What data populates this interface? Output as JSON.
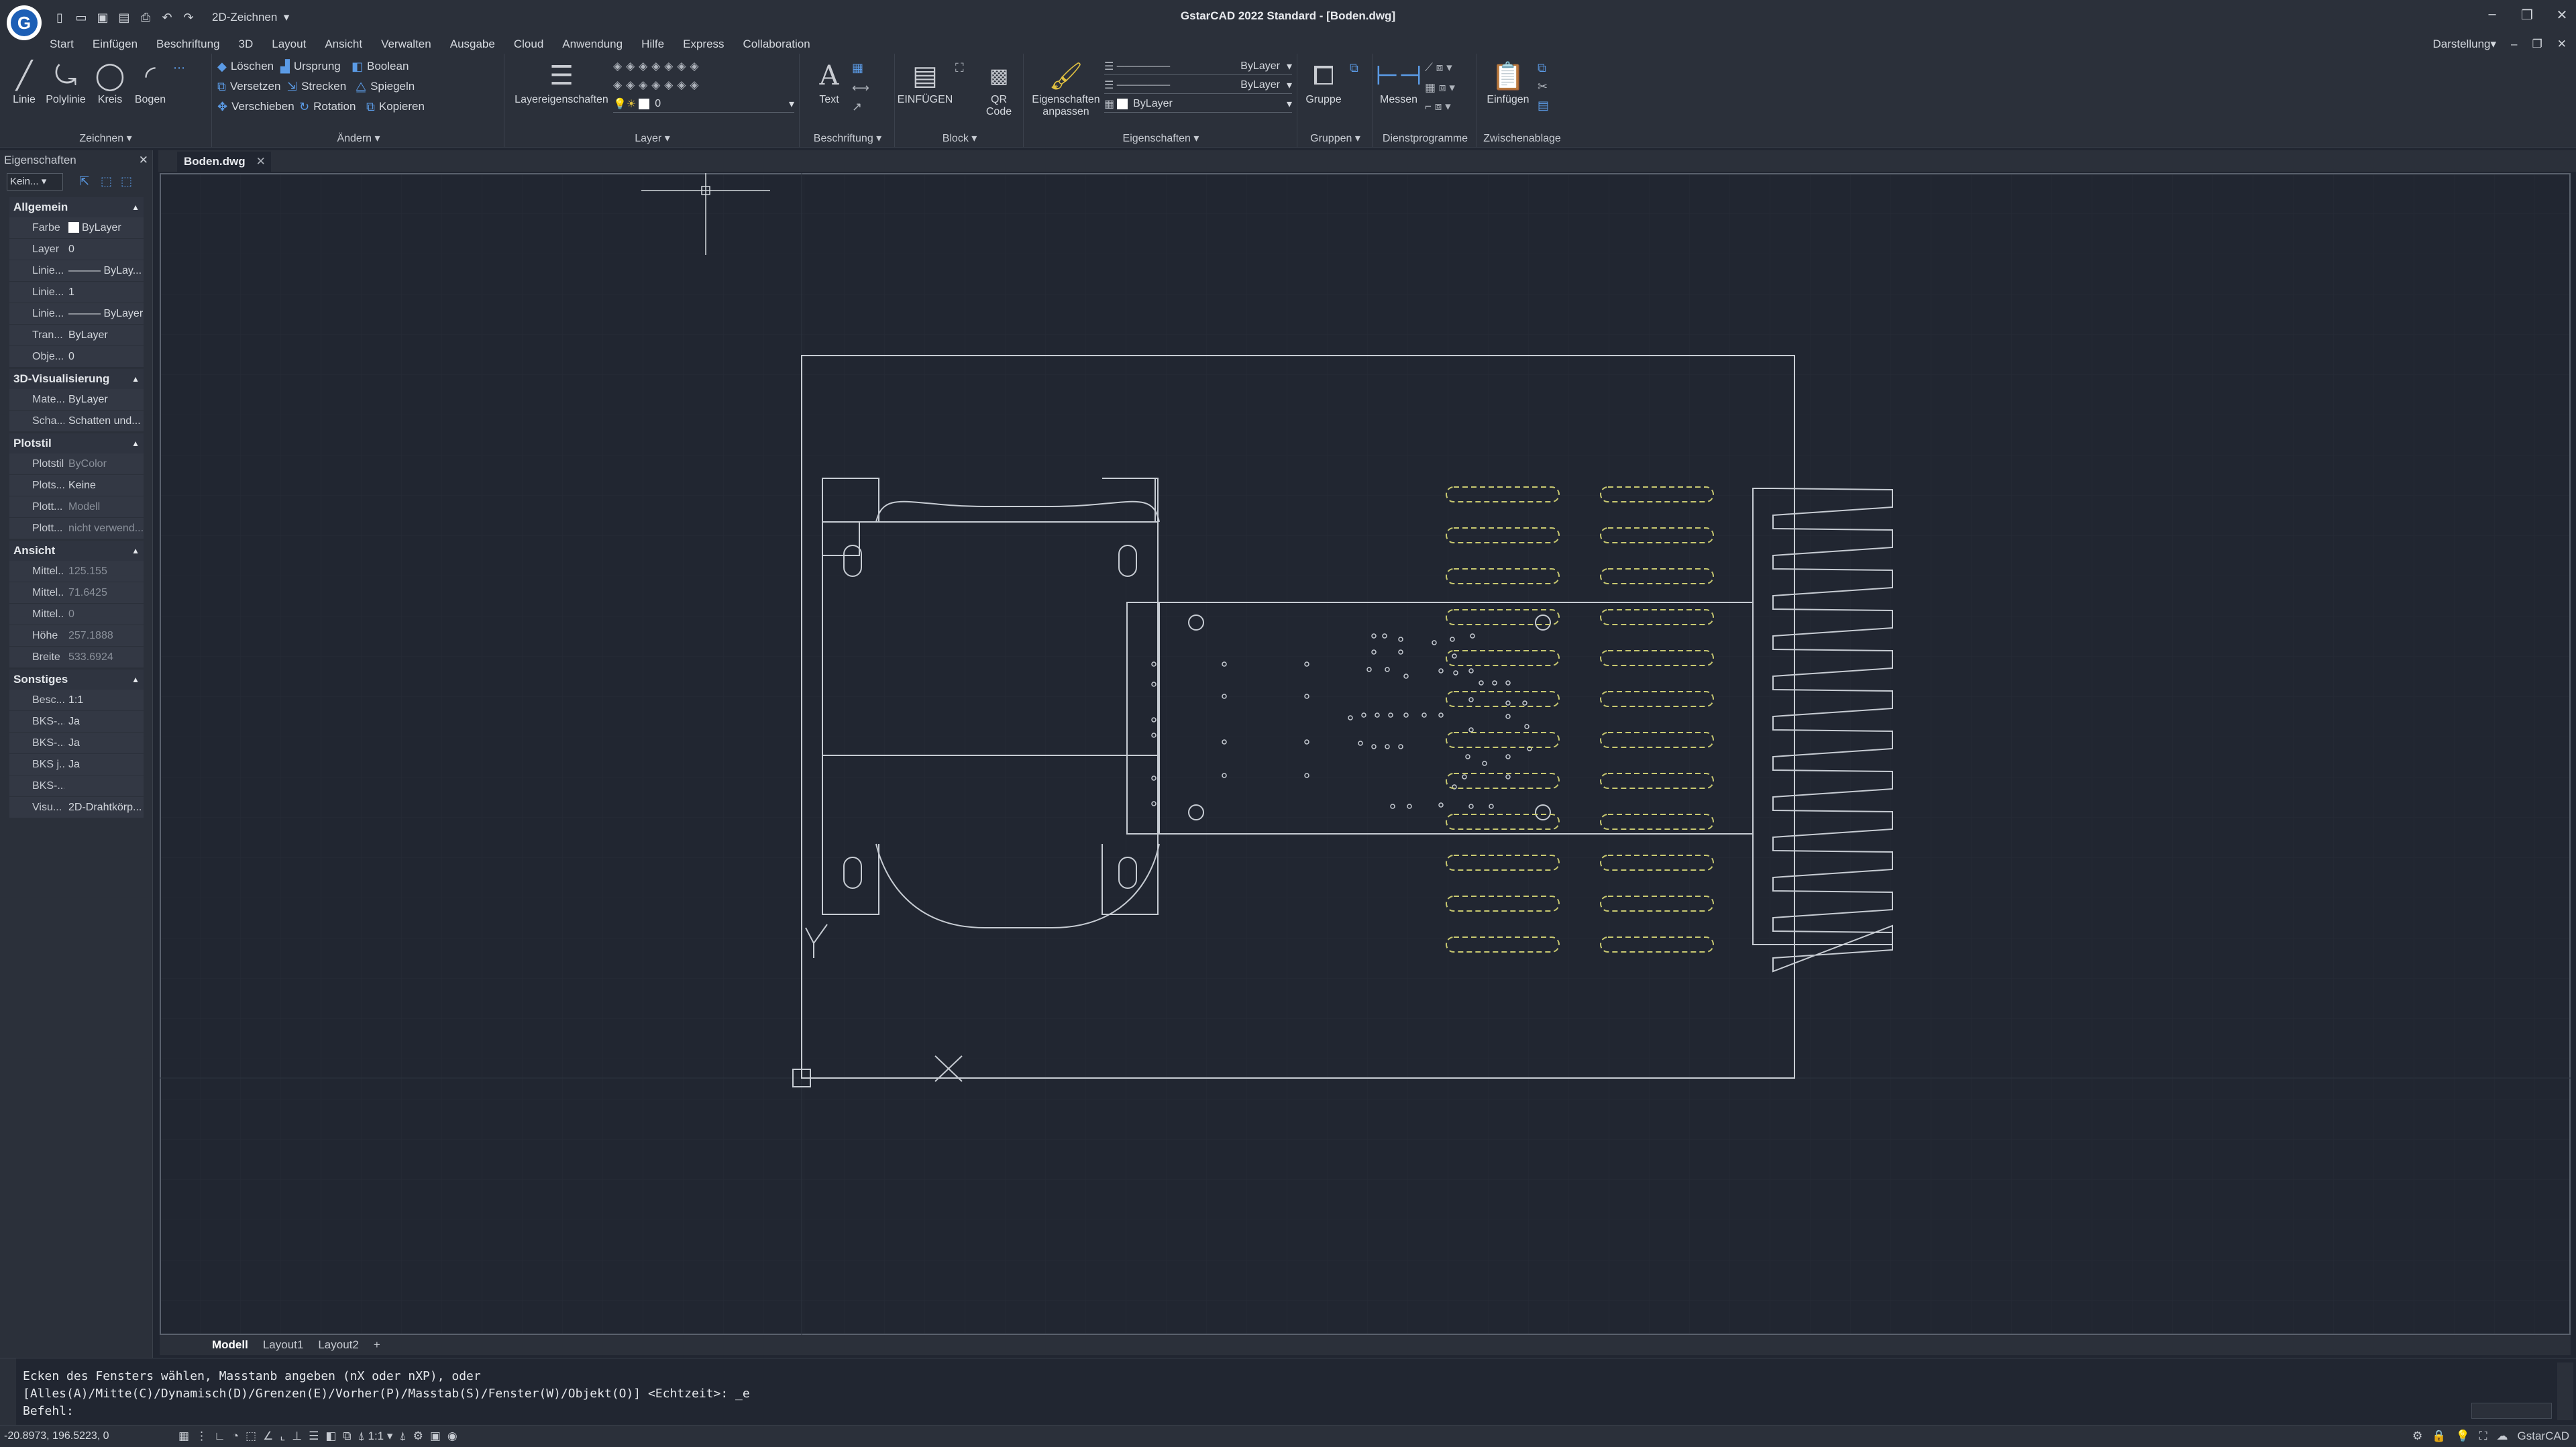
{
  "titlebar": {
    "app_title": "GstarCAD 2022 Standard - [Boden.dwg]",
    "workspace": "2D-Zeichnen",
    "qat_icons": [
      "new-file-icon",
      "open-icon",
      "save-icon",
      "save-as-icon",
      "print-icon",
      "undo-icon",
      "redo-icon"
    ]
  },
  "menu": {
    "items": [
      "Start",
      "Einfügen",
      "Beschriftung",
      "3D",
      "Layout",
      "Ansicht",
      "Verwalten",
      "Ausgabe",
      "Cloud",
      "Anwendung",
      "Hilfe",
      "Express",
      "Collaboration"
    ],
    "right_label": "Darstellung"
  },
  "ribbon": {
    "zeichnen": {
      "label": "Zeichnen",
      "tools": [
        "Linie",
        "Polylinie",
        "Kreis",
        "Bogen"
      ]
    },
    "aendern": {
      "label": "Ändern",
      "row1": [
        "Löschen",
        "Ursprung",
        "Boolean"
      ],
      "row2": [
        "Versetzen",
        "Strecken",
        "Spiegeln"
      ],
      "row3": [
        "Verschieben",
        "Rotation",
        "Kopieren"
      ]
    },
    "layer": {
      "label": "Layer",
      "big": "Layereigenschaften",
      "current": "0"
    },
    "beschriftung": {
      "label": "Beschriftung",
      "text": "Text"
    },
    "block": {
      "label": "Block",
      "insert": "EINFÜGEN",
      "qr": "QR Code"
    },
    "eigenschaften": {
      "label": "Eigenschaften",
      "match": "Eigenschaften anpassen",
      "linetype": "ByLayer",
      "lineweight": "ByLayer",
      "color": "ByLayer"
    },
    "gruppen": {
      "label": "Gruppen",
      "group": "Gruppe"
    },
    "dienst": {
      "label": "Dienstprogramme",
      "measure": "Messen"
    },
    "clipboard": {
      "label": "Zwischenablage",
      "paste": "Einfügen"
    }
  },
  "properties": {
    "title": "Eigenschaften",
    "selection": "Kein...",
    "sections": [
      {
        "name": "Allgemein",
        "rows": [
          {
            "k": "Farbe",
            "v": "ByLayer",
            "swatch": true
          },
          {
            "k": "Layer",
            "v": "0"
          },
          {
            "k": "Linie...",
            "v": "——— ByLay..."
          },
          {
            "k": "Linie...",
            "v": "1"
          },
          {
            "k": "Linie...",
            "v": "——— ByLayer"
          },
          {
            "k": "Tran...",
            "v": "ByLayer"
          },
          {
            "k": "Obje...",
            "v": "0"
          }
        ]
      },
      {
        "name": "3D-Visualisierung",
        "rows": [
          {
            "k": "Mate...",
            "v": "ByLayer"
          },
          {
            "k": "Scha...",
            "v": "Schatten und..."
          }
        ]
      },
      {
        "name": "Plotstil",
        "rows": [
          {
            "k": "Plotstil",
            "v": "ByColor",
            "dim": true
          },
          {
            "k": "Plots...",
            "v": "Keine"
          },
          {
            "k": "Plott...",
            "v": "Modell",
            "dim": true
          },
          {
            "k": "Plott...",
            "v": "nicht verwend...",
            "dim": true
          }
        ]
      },
      {
        "name": "Ansicht",
        "rows": [
          {
            "k": "Mittel...",
            "v": "125.155",
            "dim": true
          },
          {
            "k": "Mittel...",
            "v": "71.6425",
            "dim": true
          },
          {
            "k": "Mittel...",
            "v": "0",
            "dim": true
          },
          {
            "k": "Höhe",
            "v": "257.1888",
            "dim": true
          },
          {
            "k": "Breite",
            "v": "533.6924",
            "dim": true
          }
        ]
      },
      {
        "name": "Sonstiges",
        "rows": [
          {
            "k": "Besc...",
            "v": "1:1"
          },
          {
            "k": "BKS-...",
            "v": "Ja"
          },
          {
            "k": "BKS-...",
            "v": "Ja"
          },
          {
            "k": "BKS j...",
            "v": "Ja"
          },
          {
            "k": "BKS-...",
            "v": ""
          },
          {
            "k": "Visu...",
            "v": "2D-Drahtkörp..."
          }
        ]
      }
    ]
  },
  "document": {
    "tab": "Boden.dwg"
  },
  "layout_tabs": [
    "Modell",
    "Layout1",
    "Layout2"
  ],
  "command": {
    "line1": "Ecken des Fensters wählen, Masstanb angeben (nX oder nXP), oder",
    "line2": "[Alles(A)/Mitte(C)/Dynamisch(D)/Grenzen(E)/Vorher(P)/Masstab(S)/Fenster(W)/Objekt(O)] <Echtzeit>: _e",
    "line3": "Befehl:"
  },
  "status": {
    "coords": "-20.8973, 196.5223, 0",
    "scale": "1:1",
    "brand": "GstarCAD"
  },
  "colors": {
    "background": "#212631",
    "chrome": "#2b303a",
    "geometry": "#c7ccd3",
    "slots": "#c8c870",
    "accent": "#1d5fb6"
  }
}
